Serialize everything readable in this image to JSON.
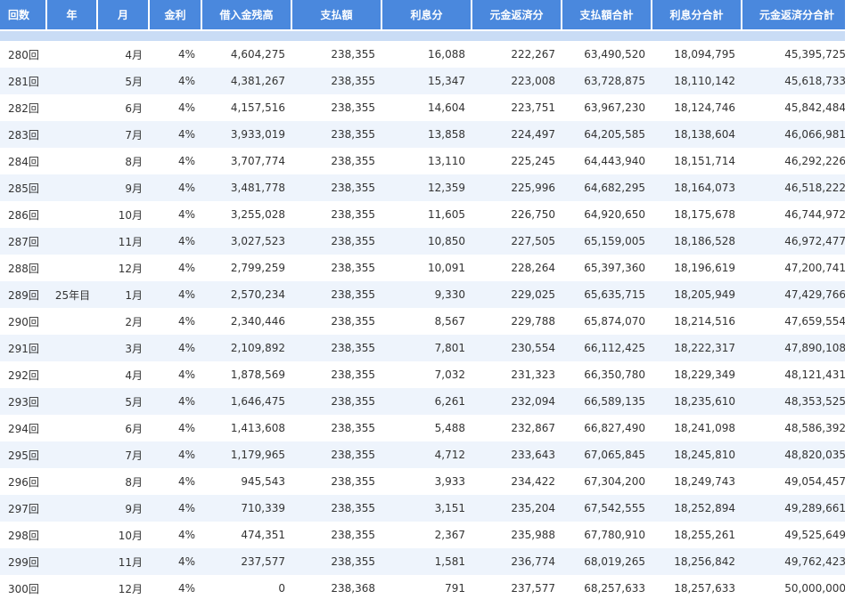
{
  "headers": [
    "回数",
    "年",
    "月",
    "金利",
    "借入金残高",
    "支払額",
    "利息分",
    "元金返済分",
    "支払額合計",
    "利息分合計",
    "元金返済分合計"
  ],
  "rows": [
    [
      "280回",
      "",
      "4月",
      "4%",
      "4,604,275",
      "238,355",
      "16,088",
      "222,267",
      "63,490,520",
      "18,094,795",
      "45,395,725"
    ],
    [
      "281回",
      "",
      "5月",
      "4%",
      "4,381,267",
      "238,355",
      "15,347",
      "223,008",
      "63,728,875",
      "18,110,142",
      "45,618,733"
    ],
    [
      "282回",
      "",
      "6月",
      "4%",
      "4,157,516",
      "238,355",
      "14,604",
      "223,751",
      "63,967,230",
      "18,124,746",
      "45,842,484"
    ],
    [
      "283回",
      "",
      "7月",
      "4%",
      "3,933,019",
      "238,355",
      "13,858",
      "224,497",
      "64,205,585",
      "18,138,604",
      "46,066,981"
    ],
    [
      "284回",
      "",
      "8月",
      "4%",
      "3,707,774",
      "238,355",
      "13,110",
      "225,245",
      "64,443,940",
      "18,151,714",
      "46,292,226"
    ],
    [
      "285回",
      "",
      "9月",
      "4%",
      "3,481,778",
      "238,355",
      "12,359",
      "225,996",
      "64,682,295",
      "18,164,073",
      "46,518,222"
    ],
    [
      "286回",
      "",
      "10月",
      "4%",
      "3,255,028",
      "238,355",
      "11,605",
      "226,750",
      "64,920,650",
      "18,175,678",
      "46,744,972"
    ],
    [
      "287回",
      "",
      "11月",
      "4%",
      "3,027,523",
      "238,355",
      "10,850",
      "227,505",
      "65,159,005",
      "18,186,528",
      "46,972,477"
    ],
    [
      "288回",
      "",
      "12月",
      "4%",
      "2,799,259",
      "238,355",
      "10,091",
      "228,264",
      "65,397,360",
      "18,196,619",
      "47,200,741"
    ],
    [
      "289回",
      "25年目",
      "1月",
      "4%",
      "2,570,234",
      "238,355",
      "9,330",
      "229,025",
      "65,635,715",
      "18,205,949",
      "47,429,766"
    ],
    [
      "290回",
      "",
      "2月",
      "4%",
      "2,340,446",
      "238,355",
      "8,567",
      "229,788",
      "65,874,070",
      "18,214,516",
      "47,659,554"
    ],
    [
      "291回",
      "",
      "3月",
      "4%",
      "2,109,892",
      "238,355",
      "7,801",
      "230,554",
      "66,112,425",
      "18,222,317",
      "47,890,108"
    ],
    [
      "292回",
      "",
      "4月",
      "4%",
      "1,878,569",
      "238,355",
      "7,032",
      "231,323",
      "66,350,780",
      "18,229,349",
      "48,121,431"
    ],
    [
      "293回",
      "",
      "5月",
      "4%",
      "1,646,475",
      "238,355",
      "6,261",
      "232,094",
      "66,589,135",
      "18,235,610",
      "48,353,525"
    ],
    [
      "294回",
      "",
      "6月",
      "4%",
      "1,413,608",
      "238,355",
      "5,488",
      "232,867",
      "66,827,490",
      "18,241,098",
      "48,586,392"
    ],
    [
      "295回",
      "",
      "7月",
      "4%",
      "1,179,965",
      "238,355",
      "4,712",
      "233,643",
      "67,065,845",
      "18,245,810",
      "48,820,035"
    ],
    [
      "296回",
      "",
      "8月",
      "4%",
      "945,543",
      "238,355",
      "3,933",
      "234,422",
      "67,304,200",
      "18,249,743",
      "49,054,457"
    ],
    [
      "297回",
      "",
      "9月",
      "4%",
      "710,339",
      "238,355",
      "3,151",
      "235,204",
      "67,542,555",
      "18,252,894",
      "49,289,661"
    ],
    [
      "298回",
      "",
      "10月",
      "4%",
      "474,351",
      "238,355",
      "2,367",
      "235,988",
      "67,780,910",
      "18,255,261",
      "49,525,649"
    ],
    [
      "299回",
      "",
      "11月",
      "4%",
      "237,577",
      "238,355",
      "1,581",
      "236,774",
      "68,019,265",
      "18,256,842",
      "49,762,423"
    ],
    [
      "300回",
      "",
      "12月",
      "4%",
      "0",
      "238,368",
      "791",
      "237,577",
      "68,257,633",
      "18,257,633",
      "50,000,000"
    ]
  ],
  "colors": {
    "header_bg": "#4a88dd",
    "header_text": "#ffffff",
    "band": "#c9dcf5",
    "row_alt": "#eef4fc"
  }
}
